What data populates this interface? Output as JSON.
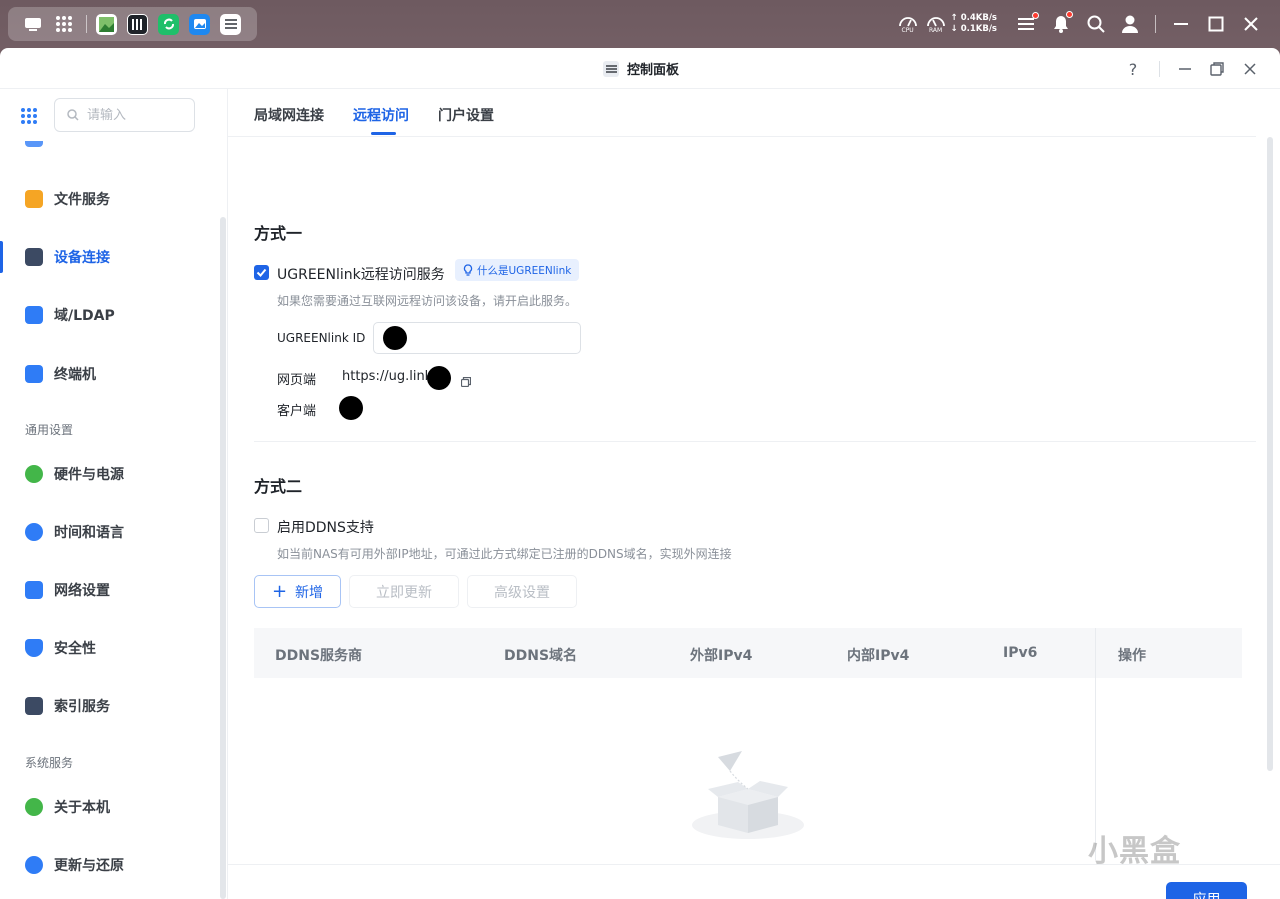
{
  "topbar": {
    "net_up": "0.4KB/s",
    "net_down": "0.1KB/s",
    "cpu_label": "CPU",
    "ram_label": "RAM"
  },
  "window": {
    "title": "控制面板",
    "help": "?"
  },
  "sidebar": {
    "search_placeholder": "请输入",
    "items": [
      {
        "label": "文件服务",
        "icon": "folder-icon",
        "color": "#f5a524"
      },
      {
        "label": "设备连接",
        "icon": "device-icon",
        "color": "#3c4a63"
      },
      {
        "label": "域/LDAP",
        "icon": "domain-icon",
        "color": "#2f7cf6"
      },
      {
        "label": "终端机",
        "icon": "terminal-icon",
        "color": "#2f7cf6"
      }
    ],
    "group_general": "通用设置",
    "general_items": [
      {
        "label": "硬件与电源",
        "icon": "hardware-icon",
        "color": "#43b649"
      },
      {
        "label": "时间和语言",
        "icon": "globe-icon",
        "color": "#2f7cf6"
      },
      {
        "label": "网络设置",
        "icon": "network-icon",
        "color": "#2f7cf6"
      },
      {
        "label": "安全性",
        "icon": "shield-icon",
        "color": "#2f7cf6"
      },
      {
        "label": "索引服务",
        "icon": "index-icon",
        "color": "#3c4a63"
      }
    ],
    "group_system": "系统服务",
    "system_items": [
      {
        "label": "关于本机",
        "icon": "info-icon",
        "color": "#43b649"
      },
      {
        "label": "更新与还原",
        "icon": "update-icon",
        "color": "#2f7cf6"
      }
    ]
  },
  "tabs": [
    "局域网连接",
    "远程访问",
    "门户设置"
  ],
  "method1": {
    "title": "方式一",
    "checkbox_label": "UGREENlink远程访问服务",
    "checked": true,
    "badge": "什么是UGREENlink",
    "hint": "如果您需要通过互联网远程访问该设备，请开启此服务。",
    "id_label": "UGREENlink ID",
    "web_label": "网页端",
    "web_value": "https://ug.link",
    "client_label": "客户端"
  },
  "method2": {
    "title": "方式二",
    "checkbox_label": "启用DDNS支持",
    "checked": false,
    "hint": "如当前NAS有可用外部IP地址，可通过此方式绑定已注册的DDNS域名，实现外网连接",
    "btn_add": "新增",
    "btn_update": "立即更新",
    "btn_advanced": "高级设置",
    "table_headers": [
      "DDNS服务商",
      "DDNS域名",
      "外部IPv4",
      "内部IPv4",
      "IPv6",
      "操作"
    ]
  },
  "footer": {
    "apply": "应用",
    "watermark": "小黑盒"
  },
  "colors": {
    "accent": "#1e64e6"
  }
}
